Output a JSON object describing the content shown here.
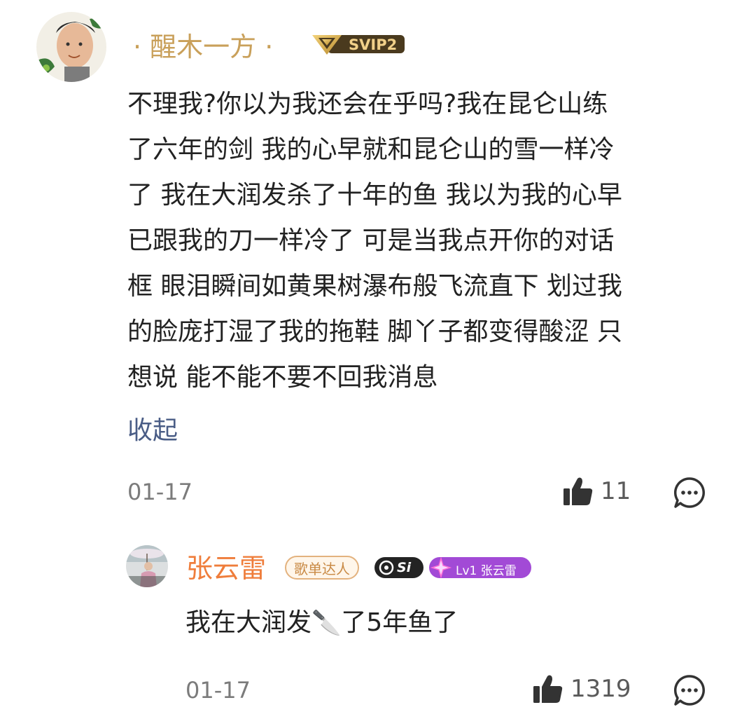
{
  "comments": [
    {
      "username": "· 醒木一方 ·",
      "vip_badge": "SVIP2",
      "lines": [
        "不理我?你以为我还会在乎吗?我在昆仑山练",
        "了六年的剑 我的心早就和昆仑山的雪一样冷",
        "了 我在大润发杀了十年的鱼 我以为我的心早",
        "已跟我的刀一样冷了 可是当我点开你的对话",
        "框 眼泪瞬间如黄果树瀑布般飞流直下 划过我",
        "的脸庞打湿了我的拖鞋 脚丫子都变得酸涩 只",
        "想说 能不能不要不回我消息"
      ],
      "collapse_label": "收起",
      "date": "01-17",
      "like_count": "11"
    },
    {
      "username": "张云雷",
      "tag_label": "歌单达人",
      "level_badge": "Si",
      "lv_badge": "Lv1 张云雷",
      "text_before": "我在大润发",
      "text_emoji": "🔪",
      "text_after": "了5年鱼了",
      "date": "01-17",
      "like_count": "1319"
    }
  ],
  "colors": {
    "username_gold": "#c9a05a",
    "username_orange": "#ef7d3b",
    "collapse_blue": "#4a5d86",
    "lv_badge_purple": "#a24ad6"
  },
  "icons": [
    "avatar",
    "vip-diamond-icon",
    "thumbs-up-icon",
    "comment-bubble-icon",
    "sparkle-icon",
    "knife-emoji"
  ]
}
